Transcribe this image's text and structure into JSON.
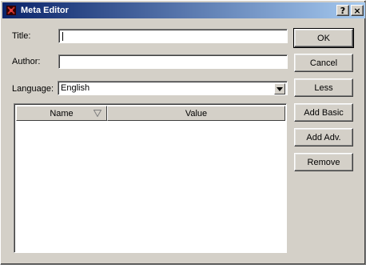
{
  "window": {
    "title": "Meta Editor",
    "help_button": "?",
    "close_button": "×"
  },
  "form": {
    "title_label": "Title:",
    "title_value": "",
    "author_label": "Author:",
    "author_value": "",
    "language_label": "Language:",
    "language_value": "English"
  },
  "table": {
    "columns": [
      "Name",
      "Value"
    ],
    "rows": []
  },
  "buttons": {
    "ok": "OK",
    "cancel": "Cancel",
    "less": "Less",
    "add_basic": "Add Basic",
    "add_adv": "Add Adv.",
    "remove": "Remove"
  },
  "colors": {
    "face": "#d4d0c8",
    "titlebar_start": "#0a246a",
    "titlebar_end": "#a6caf0"
  },
  "icons": {
    "app": "meta-editor-app-icon",
    "sort": "sort-triangle-icon",
    "dropdown": "dropdown-arrow-icon"
  }
}
